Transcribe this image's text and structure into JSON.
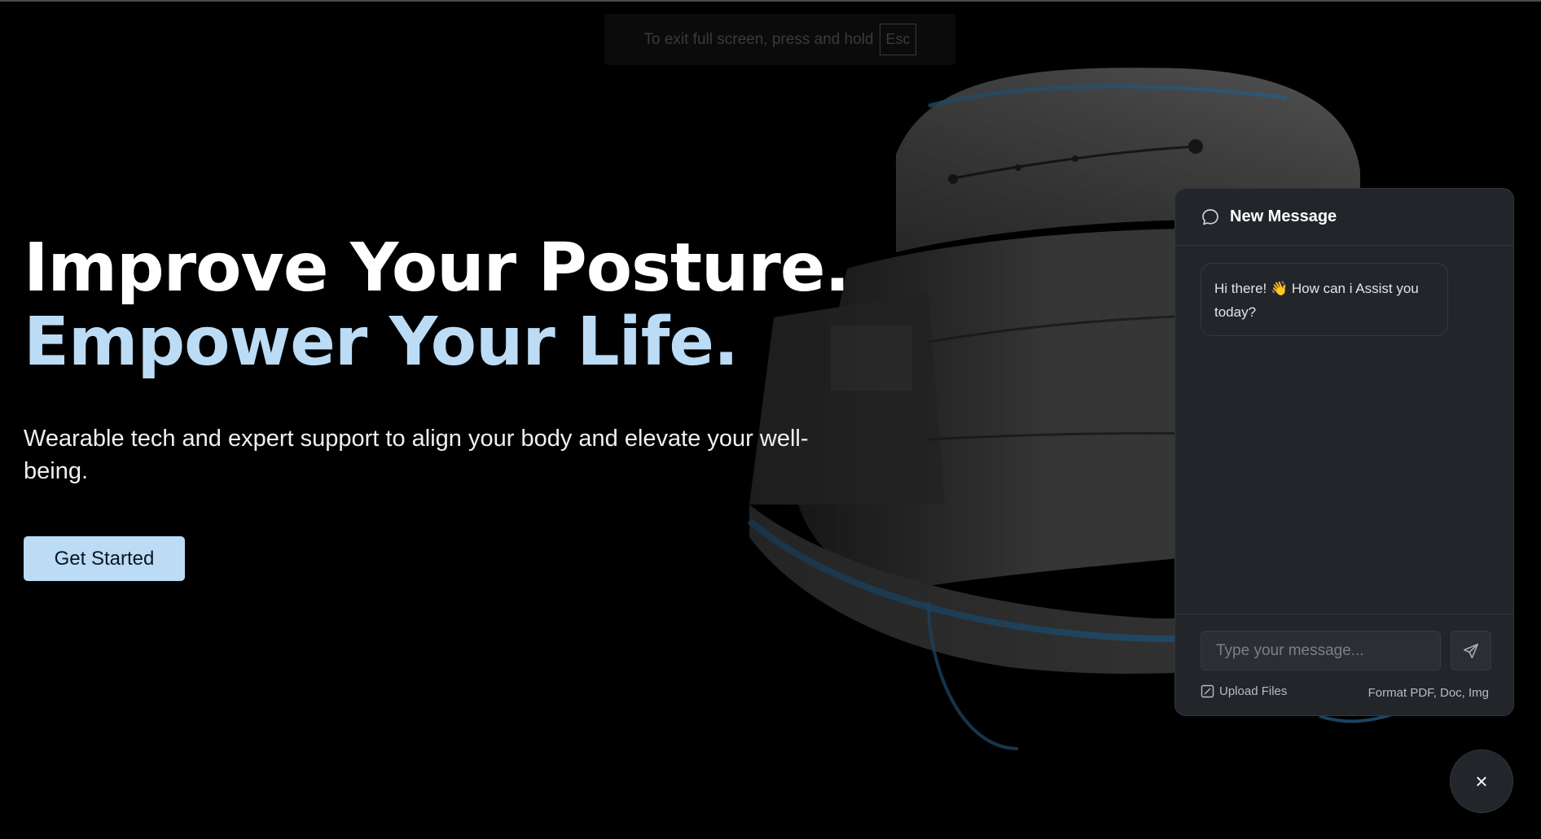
{
  "fullscreen_hint": {
    "text": "To exit full screen, press and hold",
    "key": "Esc"
  },
  "hero": {
    "title_line1": "Improve Your Posture.",
    "title_line2": "Empower Your Life.",
    "subtitle": "Wearable tech and expert support to align your body and elevate your well-being.",
    "cta_label": "Get Started"
  },
  "chat": {
    "header_title": "New Message",
    "header_icon": "chat-bubble-icon",
    "messages": [
      {
        "text": "Hi there! 👋 How can i Assist you today?"
      }
    ],
    "input_placeholder": "Type your message...",
    "send_icon": "send-icon",
    "upload_label": "Upload Files",
    "upload_icon": "upload-checkbox-icon",
    "formats_label": "Format PDF, Doc, Img"
  },
  "close_button": {
    "label": "×",
    "icon": "close-icon"
  },
  "colors": {
    "background": "#000000",
    "accent": "#bcdcf6",
    "panel": "#22252a"
  }
}
